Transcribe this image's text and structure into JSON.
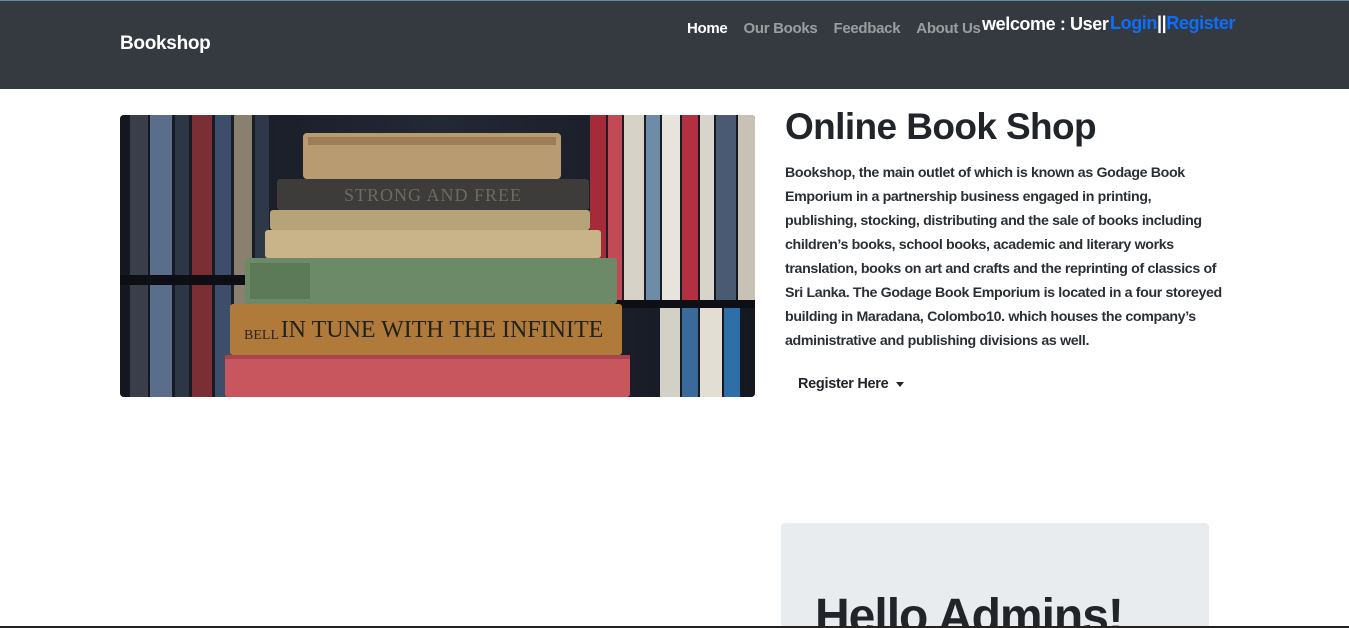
{
  "navbar": {
    "brand": "Bookshop",
    "links": [
      {
        "label": "Home",
        "active": true
      },
      {
        "label": "Our Books",
        "active": false
      },
      {
        "label": "Feedback",
        "active": false
      },
      {
        "label": "About Us",
        "active": false
      }
    ],
    "welcome": "welcome : User",
    "login_label": "Login",
    "separator": "||",
    "register_label": "Register"
  },
  "hero": {
    "image_alt": "Stack of old books",
    "book_spine_1": "STRONG AND FREE",
    "book_spine_2": "IN TUNE WITH THE INFINITE",
    "book_spine_2_side": "BELL"
  },
  "intro": {
    "title": "Online Book Shop",
    "description": "Bookshop, the main outlet of which is known as Godage Book Emporium in a partnership business engaged in printing, publishing, stocking, distributing and the sale of books including children’s books, school books, academic and literary works translation, books on art and crafts and the reprinting of classics of Sri Lanka. The Godage Book Emporium is located in a four storeyed building in Maradana, Colombo10. which houses the company’s administrative and publishing divisions as well.",
    "dropdown_label": "Register Here"
  },
  "jumbotron": {
    "title": "Hello Admins!"
  },
  "colors": {
    "navbar_bg": "#343a40",
    "link_primary": "#0d6efd",
    "jumbotron_bg": "#e9ecef"
  }
}
